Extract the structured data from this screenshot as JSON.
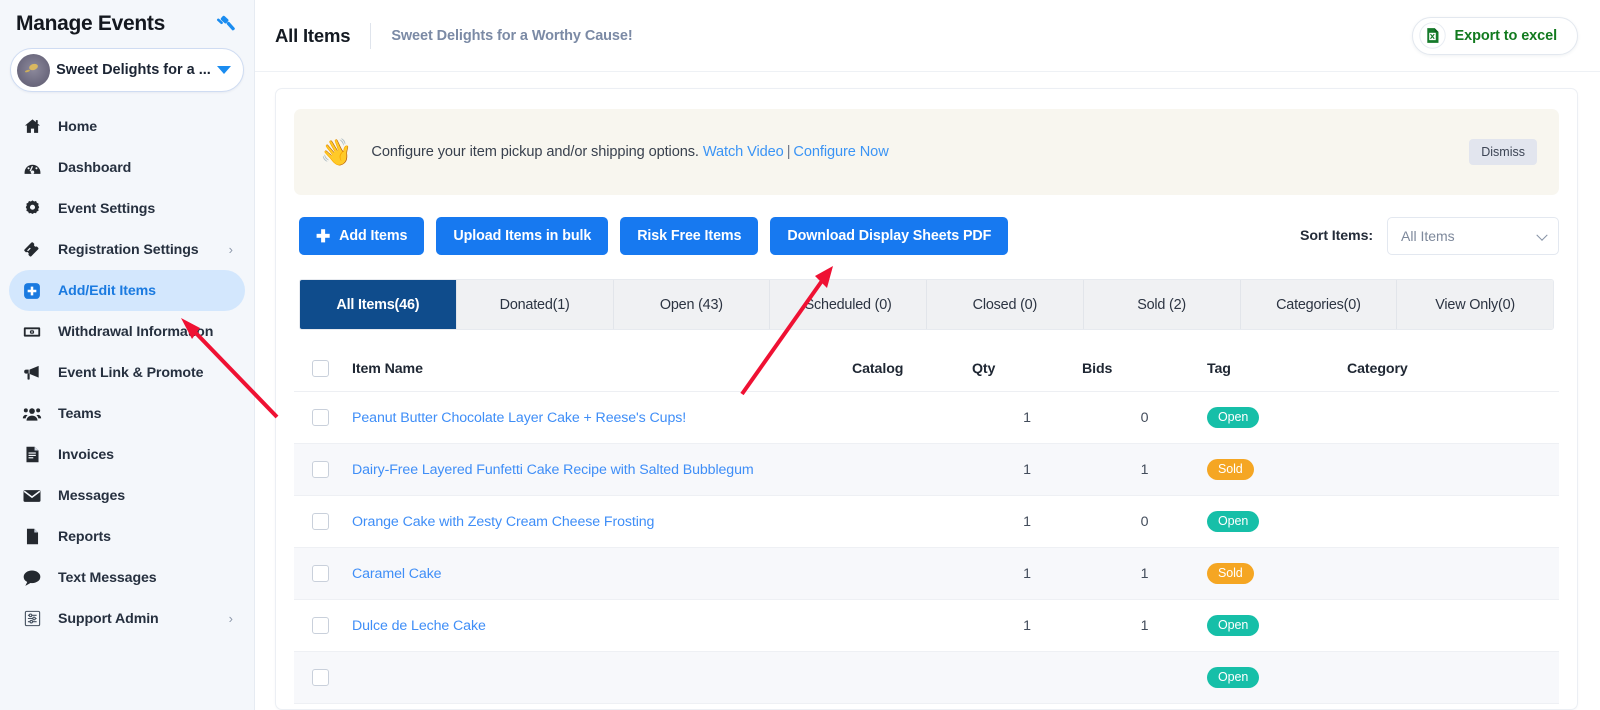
{
  "sidebar": {
    "title": "Manage Events",
    "gavel_icon": "gavel-icon",
    "event": {
      "name": "Sweet Delights for a ...",
      "avatar_icon": "event-avatar"
    },
    "items": [
      {
        "label": "Home",
        "icon": "home-icon",
        "active": false,
        "chevron": false
      },
      {
        "label": "Dashboard",
        "icon": "dashboard-icon",
        "active": false,
        "chevron": false
      },
      {
        "label": "Event Settings",
        "icon": "gear-icon",
        "active": false,
        "chevron": false
      },
      {
        "label": "Registration Settings",
        "icon": "ticket-icon",
        "active": false,
        "chevron": true
      },
      {
        "label": "Add/Edit Items",
        "icon": "plus-square-icon",
        "active": true,
        "chevron": false
      },
      {
        "label": "Withdrawal Information",
        "icon": "money-icon",
        "active": false,
        "chevron": false
      },
      {
        "label": "Event Link & Promote",
        "icon": "megaphone-icon",
        "active": false,
        "chevron": false
      },
      {
        "label": "Teams",
        "icon": "people-icon",
        "active": false,
        "chevron": false
      },
      {
        "label": "Invoices",
        "icon": "invoice-icon",
        "active": false,
        "chevron": false
      },
      {
        "label": "Messages",
        "icon": "envelope-icon",
        "active": false,
        "chevron": false
      },
      {
        "label": "Reports",
        "icon": "document-icon",
        "active": false,
        "chevron": false
      },
      {
        "label": "Text Messages",
        "icon": "chat-bubble-icon",
        "active": false,
        "chevron": false
      },
      {
        "label": "Support Admin",
        "icon": "sliders-icon",
        "active": false,
        "chevron": true
      }
    ],
    "chevron_glyph": "›"
  },
  "topbar": {
    "page_title": "All Items",
    "event_name": "Sweet Delights for a Worthy Cause!",
    "export_label": "Export to excel",
    "export_icon": "excel-file-icon"
  },
  "banner": {
    "wave_icon": "👋",
    "message": "Configure your item pickup and/or shipping options.",
    "link_watch": "Watch Video",
    "separator": "|",
    "link_configure": "Configure Now",
    "dismiss_label": "Dismiss"
  },
  "actions": {
    "add_items": "Add Items",
    "add_items_icon": "plus-icon",
    "upload_bulk": "Upload Items in bulk",
    "risk_free": "Risk Free Items",
    "download_pdf": "Download Display Sheets PDF",
    "sort_label": "Sort Items:",
    "sort_value": "All Items",
    "sort_options": [
      "All Items"
    ],
    "chevron_icon": "chevron-down-icon"
  },
  "tabs": [
    {
      "label": "All Items(46)",
      "active": true
    },
    {
      "label": "Donated(1)",
      "active": false
    },
    {
      "label": "Open (43)",
      "active": false
    },
    {
      "label": "Scheduled (0)",
      "active": false
    },
    {
      "label": "Closed (0)",
      "active": false
    },
    {
      "label": "Sold (2)",
      "active": false
    },
    {
      "label": "Categories(0)",
      "active": false
    },
    {
      "label": "View Only(0)",
      "active": false
    }
  ],
  "table": {
    "headers": {
      "select_all": "select-all-checkbox",
      "item_name": "Item Name",
      "catalog": "Catalog",
      "qty": "Qty",
      "bids": "Bids",
      "tag": "Tag",
      "category": "Category"
    },
    "rows": [
      {
        "name": "Peanut Butter Chocolate Layer Cake + Reese's Cups!",
        "catalog": "",
        "qty": "1",
        "bids": "0",
        "tag": "Open",
        "category": ""
      },
      {
        "name": "Dairy-Free Layered Funfetti Cake Recipe with Salted Bubblegum",
        "catalog": "",
        "qty": "1",
        "bids": "1",
        "tag": "Sold",
        "category": ""
      },
      {
        "name": "Orange Cake with Zesty Cream Cheese Frosting",
        "catalog": "",
        "qty": "1",
        "bids": "0",
        "tag": "Open",
        "category": ""
      },
      {
        "name": "Caramel Cake",
        "catalog": "",
        "qty": "1",
        "bids": "1",
        "tag": "Sold",
        "category": ""
      },
      {
        "name": "Dulce de Leche Cake",
        "catalog": "",
        "qty": "1",
        "bids": "1",
        "tag": "Open",
        "category": ""
      },
      {
        "name": "",
        "catalog": "",
        "qty": "",
        "bids": "",
        "tag": "Open",
        "category": ""
      }
    ]
  },
  "colors": {
    "accent_blue": "#1779f0",
    "active_tab": "#0f4c8c",
    "badge_open": "#16bfa8",
    "badge_sold": "#f5a623",
    "link_blue": "#3f8ef7",
    "export_green": "#127a1f",
    "annotation_red": "#ef1133"
  },
  "annotations": [
    {
      "name": "arrow-to-sidebar-add-edit-items"
    },
    {
      "name": "arrow-to-download-display-sheets-pdf"
    }
  ]
}
